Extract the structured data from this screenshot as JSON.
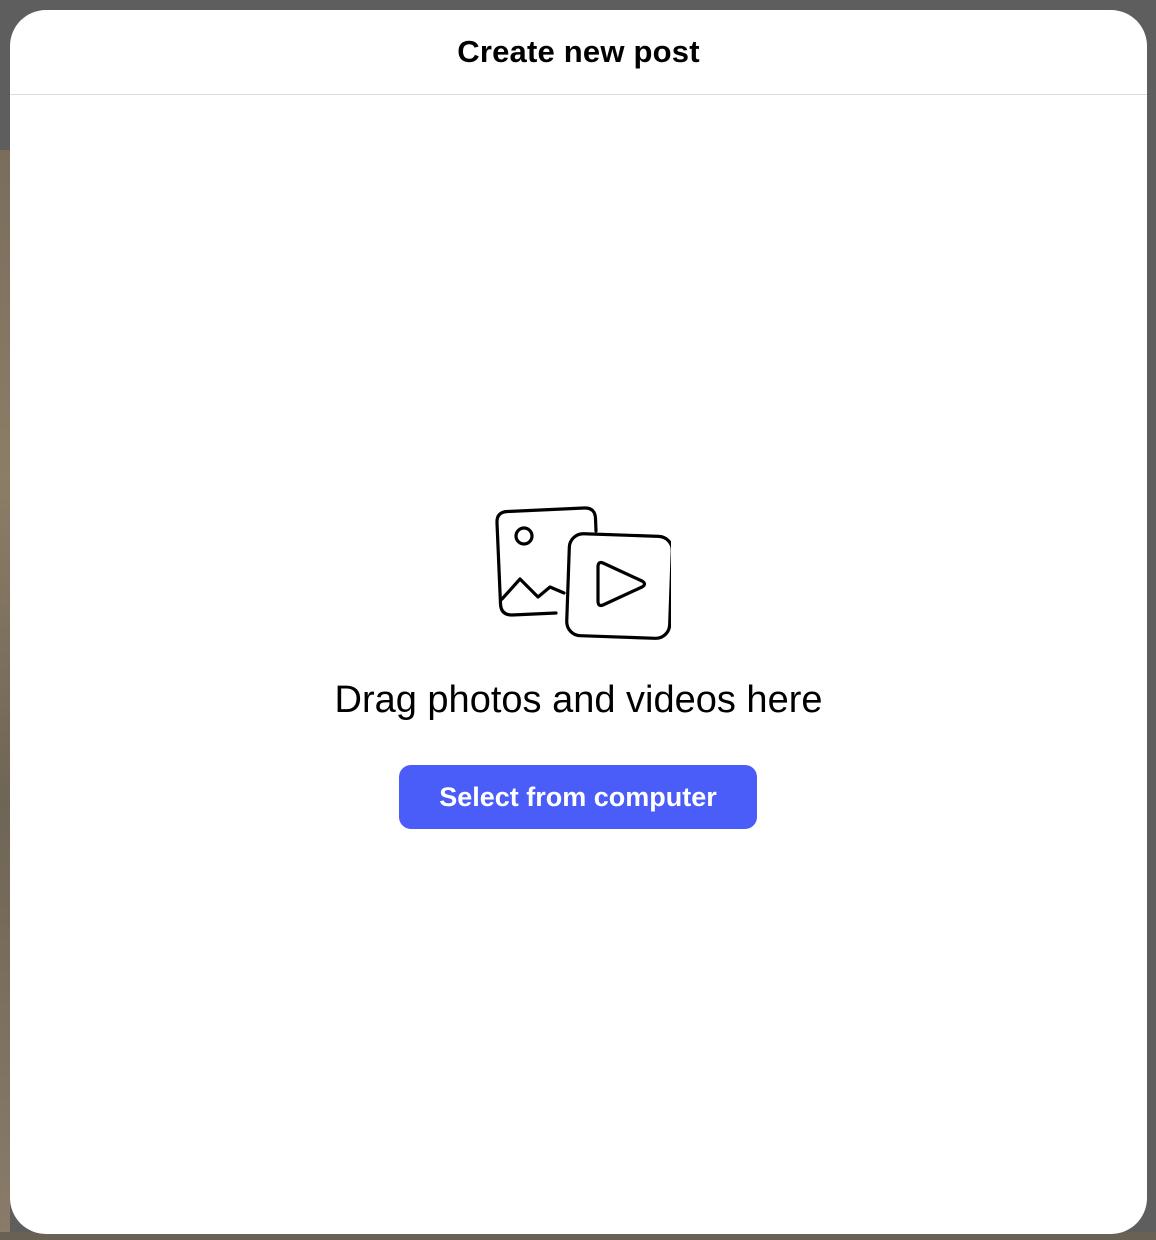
{
  "modal": {
    "title": "Create new post",
    "icon": "photo-video-icon",
    "drop_text": "Drag photos and videos here",
    "select_button_label": "Select from computer"
  },
  "colors": {
    "accent": "#4a5df9",
    "overlay": "#5e5e5e",
    "divider": "#dbdbdb"
  }
}
